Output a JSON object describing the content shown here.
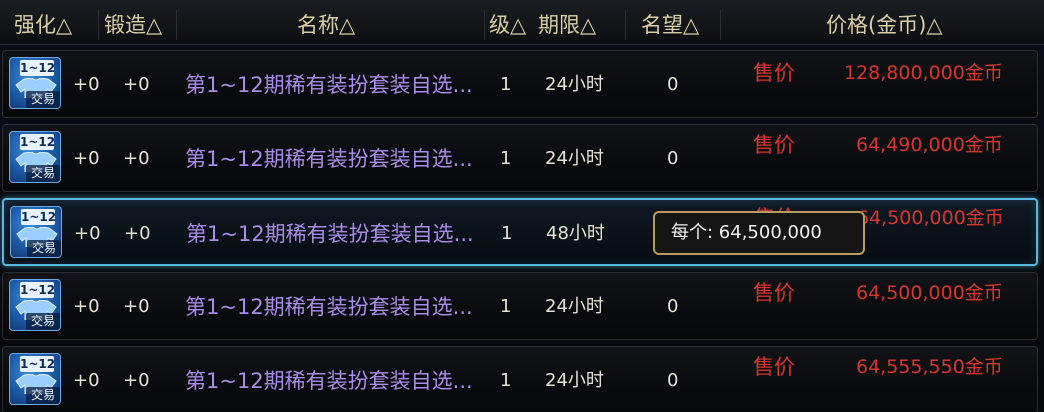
{
  "header": {
    "columns": [
      {
        "label": "强化△"
      },
      {
        "label": "锻造△"
      },
      {
        "label": "名称△"
      },
      {
        "label": "级△"
      },
      {
        "label": "期限△"
      },
      {
        "label": "名望△"
      },
      {
        "label": "价格(金币)△"
      }
    ]
  },
  "items": [
    {
      "icon_tag": "1~12",
      "icon_trade": "交易",
      "enhance": "+0",
      "forge": "+0",
      "name": "第1~12期稀有装扮套装自选...",
      "level": "1",
      "duration": "24小时",
      "renown": "0",
      "sale_label": "售价",
      "price": "128,800,000金币"
    },
    {
      "icon_tag": "1~12",
      "icon_trade": "交易",
      "enhance": "+0",
      "forge": "+0",
      "name": "第1~12期稀有装扮套装自选...",
      "level": "1",
      "duration": "24小时",
      "renown": "0",
      "sale_label": "售价",
      "price": "64,490,000金币"
    },
    {
      "icon_tag": "1~12",
      "icon_trade": "交易",
      "enhance": "+0",
      "forge": "+0",
      "name": "第1~12期稀有装扮套装自选...",
      "level": "1",
      "duration": "48小时",
      "renown": "0",
      "sale_label": "售价",
      "price": "64,500,000金币"
    },
    {
      "icon_tag": "1~12",
      "icon_trade": "交易",
      "enhance": "+0",
      "forge": "+0",
      "name": "第1~12期稀有装扮套装自选...",
      "level": "1",
      "duration": "24小时",
      "renown": "0",
      "sale_label": "售价",
      "price": "64,500,000金币"
    },
    {
      "icon_tag": "1~12",
      "icon_trade": "交易",
      "enhance": "+0",
      "forge": "+0",
      "name": "第1~12期稀有装扮套装自选...",
      "level": "1",
      "duration": "24小时",
      "renown": "0",
      "sale_label": "售价",
      "price": "64,555,550金币"
    }
  ],
  "tooltip": {
    "text": "每个: 64,500,000"
  },
  "colors": {
    "name": "#a98ce6",
    "price": "#d5372e",
    "header": "#d8cfa6",
    "selection": "#58b7dc",
    "tooltip_border": "#b89b5e"
  },
  "icon_name": "costume-shirt-icon"
}
